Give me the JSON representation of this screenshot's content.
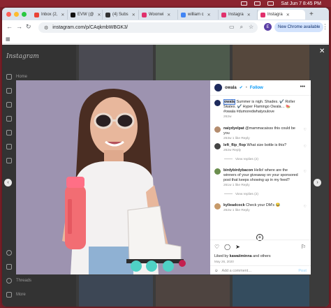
{
  "menubar": {
    "datetime": "Sat Jun 7  8:45 PM"
  },
  "tabs": [
    {
      "label": "Inbox (2,",
      "color": "#ea4335"
    },
    {
      "label": "EVW (@",
      "color": "#111111"
    },
    {
      "label": "(4) Subs",
      "color": "#333333"
    },
    {
      "label": "Woonwi",
      "color": "#e1306c"
    },
    {
      "label": "william c",
      "color": "#4285f4"
    },
    {
      "label": "Instagra",
      "color": "#e1306c"
    },
    {
      "label": "Instagra",
      "color": "#e1306c",
      "active": true
    }
  ],
  "toolbar": {
    "url": "instagram.com/p/CAqkmbWBGK3/",
    "profile_letter": "E",
    "new_chrome": "New Chrome available"
  },
  "sidebar": {
    "logo": "Instagram",
    "items": [
      "Home",
      "Threads",
      "More"
    ]
  },
  "post": {
    "username": "owala",
    "follow": "Follow",
    "caption_user": "owala",
    "caption": "Summer is nigh. Shades. ✔️ Roller Skates. ✔️ Hyper Flamingo Owala… 🍉 #owala #dumoredwhatyoulove",
    "caption_age": "262w",
    "comments": [
      {
        "user": "naiydyelpat",
        "text": "@mammacaisss this could be you",
        "meta": "253w  1 like  Reply",
        "color": "#b48c6e"
      },
      {
        "user": "left_flip_flop",
        "text": "What size bottle is this?",
        "meta": "262w  Reply",
        "color": "#444444",
        "replies": "View replies (2)"
      },
      {
        "user": "birdybirdybacon",
        "text": "Hello! where are the winners of your giveaway on your sponsored post that keeps showing up in my feed?",
        "meta": "261w  1 like  Reply",
        "color": "#6b8e4e",
        "replies": "View replies (2)"
      },
      {
        "user": "kylieadcock",
        "text": "Check your DM's 😂",
        "meta": "262w  1 like  Reply",
        "color": "#c79a6a"
      }
    ],
    "liked_by_prefix": "Liked by",
    "liked_by_user": "kawaiiminna",
    "liked_by_suffix": "and others",
    "date": "May 26, 2020",
    "add_comment_placeholder": "Add a comment…",
    "post_label": "Post"
  },
  "colors": {
    "accent": "#0095f6",
    "photo_bg": "#9d93b0",
    "bottle": "#f26d73",
    "skate_wheel": "#4fd1c5"
  }
}
